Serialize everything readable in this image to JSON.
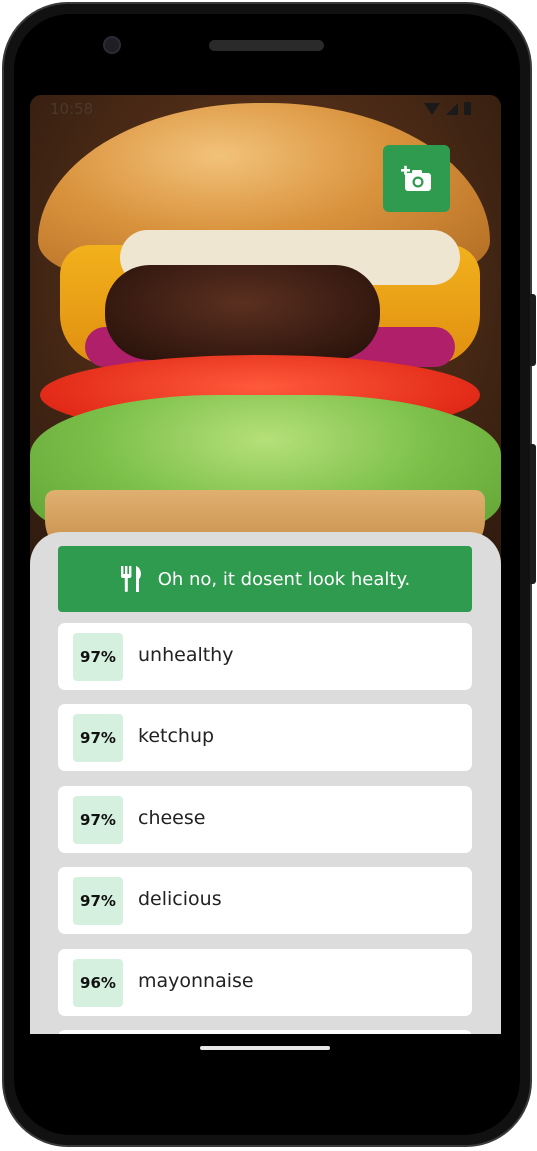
{
  "status_bar": {
    "time": "10:58"
  },
  "icons": {
    "camera_button": "add-photo-camera-icon",
    "banner": "fork-knife-icon",
    "status": [
      "wifi-icon",
      "signal-icon",
      "battery-icon"
    ]
  },
  "colors": {
    "accent": "#2e9b4e",
    "badge_bg": "#d6f0df",
    "sheet_bg": "#dcdcdc"
  },
  "result": {
    "message": "Oh no, it dosent look healty."
  },
  "labels": [
    {
      "confidence": "97%",
      "label": "unhealthy"
    },
    {
      "confidence": "97%",
      "label": "ketchup"
    },
    {
      "confidence": "97%",
      "label": "cheese"
    },
    {
      "confidence": "97%",
      "label": "delicious"
    },
    {
      "confidence": "96%",
      "label": "mayonnaise"
    }
  ]
}
